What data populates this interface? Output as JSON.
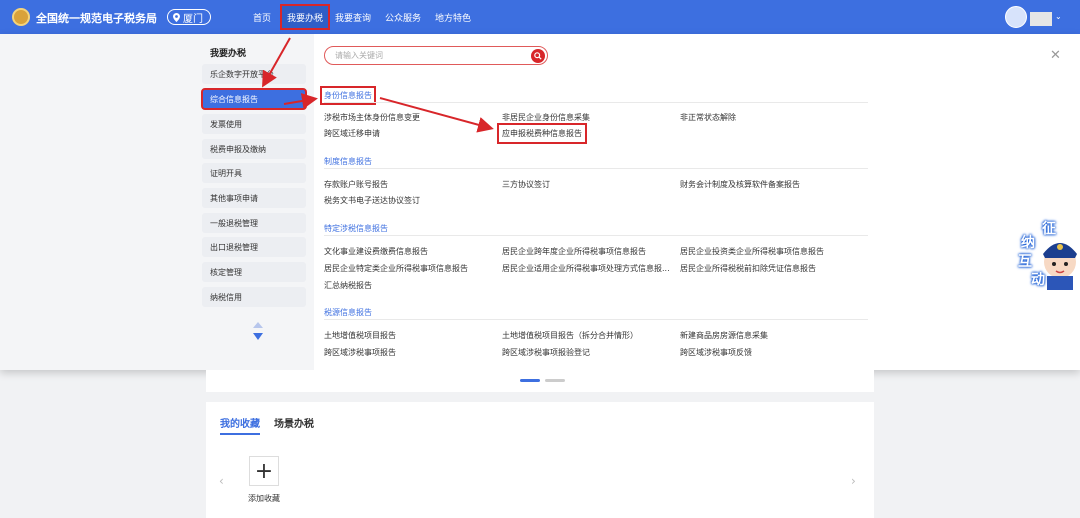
{
  "header": {
    "app_title": "全国统一规范电子税务局",
    "city": "厦门",
    "nav": [
      "首页",
      "我要办税",
      "我要查询",
      "公众服务",
      "地方特色"
    ],
    "active_nav": "我要办税"
  },
  "sidebar": {
    "title": "我要办税",
    "items": [
      {
        "label": "乐企数字开放平台"
      },
      {
        "label": "综合信息报告"
      },
      {
        "label": "发票使用"
      },
      {
        "label": "税费申报及缴纳"
      },
      {
        "label": "证明开具"
      },
      {
        "label": "其他事项申请"
      },
      {
        "label": "一般退税管理"
      },
      {
        "label": "出口退税管理"
      },
      {
        "label": "核定管理"
      },
      {
        "label": "纳税信用"
      }
    ],
    "active_index": 1
  },
  "search": {
    "placeholder": "请输入关键词"
  },
  "sections": [
    {
      "title": "身份信息报告",
      "links": [
        "涉税市场主体身份信息变更",
        "非居民企业身份信息采集",
        "非正常状态解除",
        "跨区域迁移申请",
        "应申报税费种信息报告"
      ]
    },
    {
      "title": "制度信息报告",
      "links": [
        "存款账户账号报告",
        "三方协议签订",
        "财务会计制度及核算软件备案报告",
        "税务文书电子送达协议签订"
      ]
    },
    {
      "title": "特定涉税信息报告",
      "links": [
        "文化事业建设费缴费信息报告",
        "居民企业跨年度企业所得税事项信息报告",
        "居民企业投资类企业所得税事项信息报告",
        "居民企业特定类企业所得税事项信息报告",
        "居民企业适用企业所得税事项处理方式信息报...",
        "居民企业所得税税前扣除凭证信息报告",
        "汇总纳税报告"
      ]
    },
    {
      "title": "税源信息报告",
      "links": [
        "土地增值税项目报告",
        "土地增值税项目报告（拆分合并情形）",
        "新建商品房房源信息采集",
        "跨区域涉税事项报告",
        "跨区域涉税事项报验登记",
        "跨区域涉税事项反馈"
      ]
    }
  ],
  "favorites": {
    "tabs": [
      "我的收藏",
      "场景办税"
    ],
    "add_label": "添加收藏"
  },
  "mascot": {
    "chars": [
      "征",
      "纳",
      "互",
      "动"
    ]
  },
  "colors": {
    "primary": "#3d6fe0",
    "annotation": "#d8262a"
  }
}
